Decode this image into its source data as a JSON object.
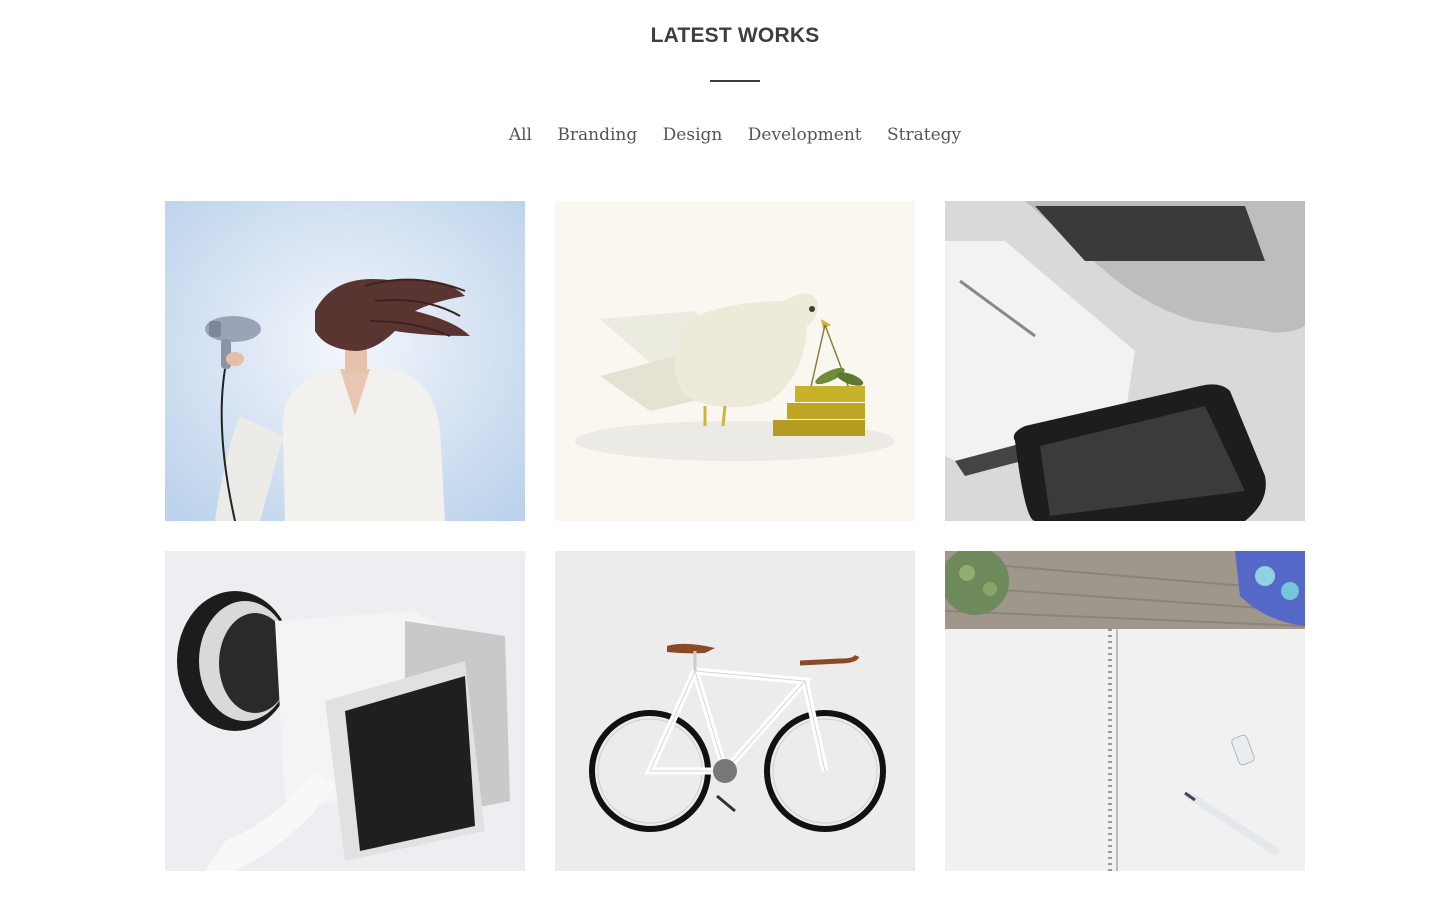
{
  "section": {
    "title": "LATEST WORKS"
  },
  "filters": [
    {
      "label": "All"
    },
    {
      "label": "Branding"
    },
    {
      "label": "Design"
    },
    {
      "label": "Development"
    },
    {
      "label": "Strategy"
    }
  ],
  "works": [
    {
      "subject": "woman-with-hair-dryer"
    },
    {
      "subject": "dove-with-olive-branch-illustration"
    },
    {
      "subject": "laptop-notebook-phone-desk"
    },
    {
      "subject": "mirrorless-camera"
    },
    {
      "subject": "white-fixed-gear-bicycle"
    },
    {
      "subject": "spiral-notebook-on-wooden-desk"
    }
  ],
  "colors": {
    "heading": "#3e3e3e",
    "filter_text": "#555555",
    "background": "#ffffff"
  }
}
